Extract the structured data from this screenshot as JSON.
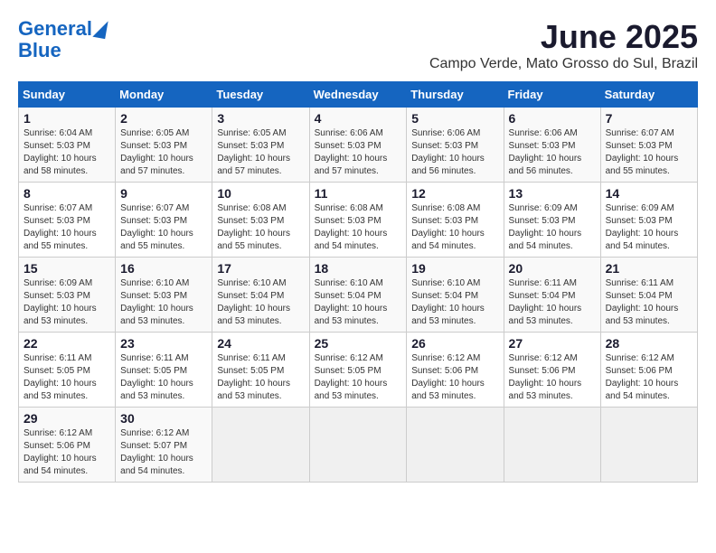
{
  "logo": {
    "line1": "General",
    "line2": "Blue"
  },
  "title": "June 2025",
  "subtitle": "Campo Verde, Mato Grosso do Sul, Brazil",
  "days_of_week": [
    "Sunday",
    "Monday",
    "Tuesday",
    "Wednesday",
    "Thursday",
    "Friday",
    "Saturday"
  ],
  "weeks": [
    [
      {
        "day": "1",
        "info": "Sunrise: 6:04 AM\nSunset: 5:03 PM\nDaylight: 10 hours\nand 58 minutes."
      },
      {
        "day": "2",
        "info": "Sunrise: 6:05 AM\nSunset: 5:03 PM\nDaylight: 10 hours\nand 57 minutes."
      },
      {
        "day": "3",
        "info": "Sunrise: 6:05 AM\nSunset: 5:03 PM\nDaylight: 10 hours\nand 57 minutes."
      },
      {
        "day": "4",
        "info": "Sunrise: 6:06 AM\nSunset: 5:03 PM\nDaylight: 10 hours\nand 57 minutes."
      },
      {
        "day": "5",
        "info": "Sunrise: 6:06 AM\nSunset: 5:03 PM\nDaylight: 10 hours\nand 56 minutes."
      },
      {
        "day": "6",
        "info": "Sunrise: 6:06 AM\nSunset: 5:03 PM\nDaylight: 10 hours\nand 56 minutes."
      },
      {
        "day": "7",
        "info": "Sunrise: 6:07 AM\nSunset: 5:03 PM\nDaylight: 10 hours\nand 55 minutes."
      }
    ],
    [
      {
        "day": "8",
        "info": "Sunrise: 6:07 AM\nSunset: 5:03 PM\nDaylight: 10 hours\nand 55 minutes."
      },
      {
        "day": "9",
        "info": "Sunrise: 6:07 AM\nSunset: 5:03 PM\nDaylight: 10 hours\nand 55 minutes."
      },
      {
        "day": "10",
        "info": "Sunrise: 6:08 AM\nSunset: 5:03 PM\nDaylight: 10 hours\nand 55 minutes."
      },
      {
        "day": "11",
        "info": "Sunrise: 6:08 AM\nSunset: 5:03 PM\nDaylight: 10 hours\nand 54 minutes."
      },
      {
        "day": "12",
        "info": "Sunrise: 6:08 AM\nSunset: 5:03 PM\nDaylight: 10 hours\nand 54 minutes."
      },
      {
        "day": "13",
        "info": "Sunrise: 6:09 AM\nSunset: 5:03 PM\nDaylight: 10 hours\nand 54 minutes."
      },
      {
        "day": "14",
        "info": "Sunrise: 6:09 AM\nSunset: 5:03 PM\nDaylight: 10 hours\nand 54 minutes."
      }
    ],
    [
      {
        "day": "15",
        "info": "Sunrise: 6:09 AM\nSunset: 5:03 PM\nDaylight: 10 hours\nand 53 minutes."
      },
      {
        "day": "16",
        "info": "Sunrise: 6:10 AM\nSunset: 5:03 PM\nDaylight: 10 hours\nand 53 minutes."
      },
      {
        "day": "17",
        "info": "Sunrise: 6:10 AM\nSunset: 5:04 PM\nDaylight: 10 hours\nand 53 minutes."
      },
      {
        "day": "18",
        "info": "Sunrise: 6:10 AM\nSunset: 5:04 PM\nDaylight: 10 hours\nand 53 minutes."
      },
      {
        "day": "19",
        "info": "Sunrise: 6:10 AM\nSunset: 5:04 PM\nDaylight: 10 hours\nand 53 minutes."
      },
      {
        "day": "20",
        "info": "Sunrise: 6:11 AM\nSunset: 5:04 PM\nDaylight: 10 hours\nand 53 minutes."
      },
      {
        "day": "21",
        "info": "Sunrise: 6:11 AM\nSunset: 5:04 PM\nDaylight: 10 hours\nand 53 minutes."
      }
    ],
    [
      {
        "day": "22",
        "info": "Sunrise: 6:11 AM\nSunset: 5:05 PM\nDaylight: 10 hours\nand 53 minutes."
      },
      {
        "day": "23",
        "info": "Sunrise: 6:11 AM\nSunset: 5:05 PM\nDaylight: 10 hours\nand 53 minutes."
      },
      {
        "day": "24",
        "info": "Sunrise: 6:11 AM\nSunset: 5:05 PM\nDaylight: 10 hours\nand 53 minutes."
      },
      {
        "day": "25",
        "info": "Sunrise: 6:12 AM\nSunset: 5:05 PM\nDaylight: 10 hours\nand 53 minutes."
      },
      {
        "day": "26",
        "info": "Sunrise: 6:12 AM\nSunset: 5:06 PM\nDaylight: 10 hours\nand 53 minutes."
      },
      {
        "day": "27",
        "info": "Sunrise: 6:12 AM\nSunset: 5:06 PM\nDaylight: 10 hours\nand 53 minutes."
      },
      {
        "day": "28",
        "info": "Sunrise: 6:12 AM\nSunset: 5:06 PM\nDaylight: 10 hours\nand 54 minutes."
      }
    ],
    [
      {
        "day": "29",
        "info": "Sunrise: 6:12 AM\nSunset: 5:06 PM\nDaylight: 10 hours\nand 54 minutes."
      },
      {
        "day": "30",
        "info": "Sunrise: 6:12 AM\nSunset: 5:07 PM\nDaylight: 10 hours\nand 54 minutes."
      },
      {
        "day": "",
        "info": ""
      },
      {
        "day": "",
        "info": ""
      },
      {
        "day": "",
        "info": ""
      },
      {
        "day": "",
        "info": ""
      },
      {
        "day": "",
        "info": ""
      }
    ]
  ]
}
